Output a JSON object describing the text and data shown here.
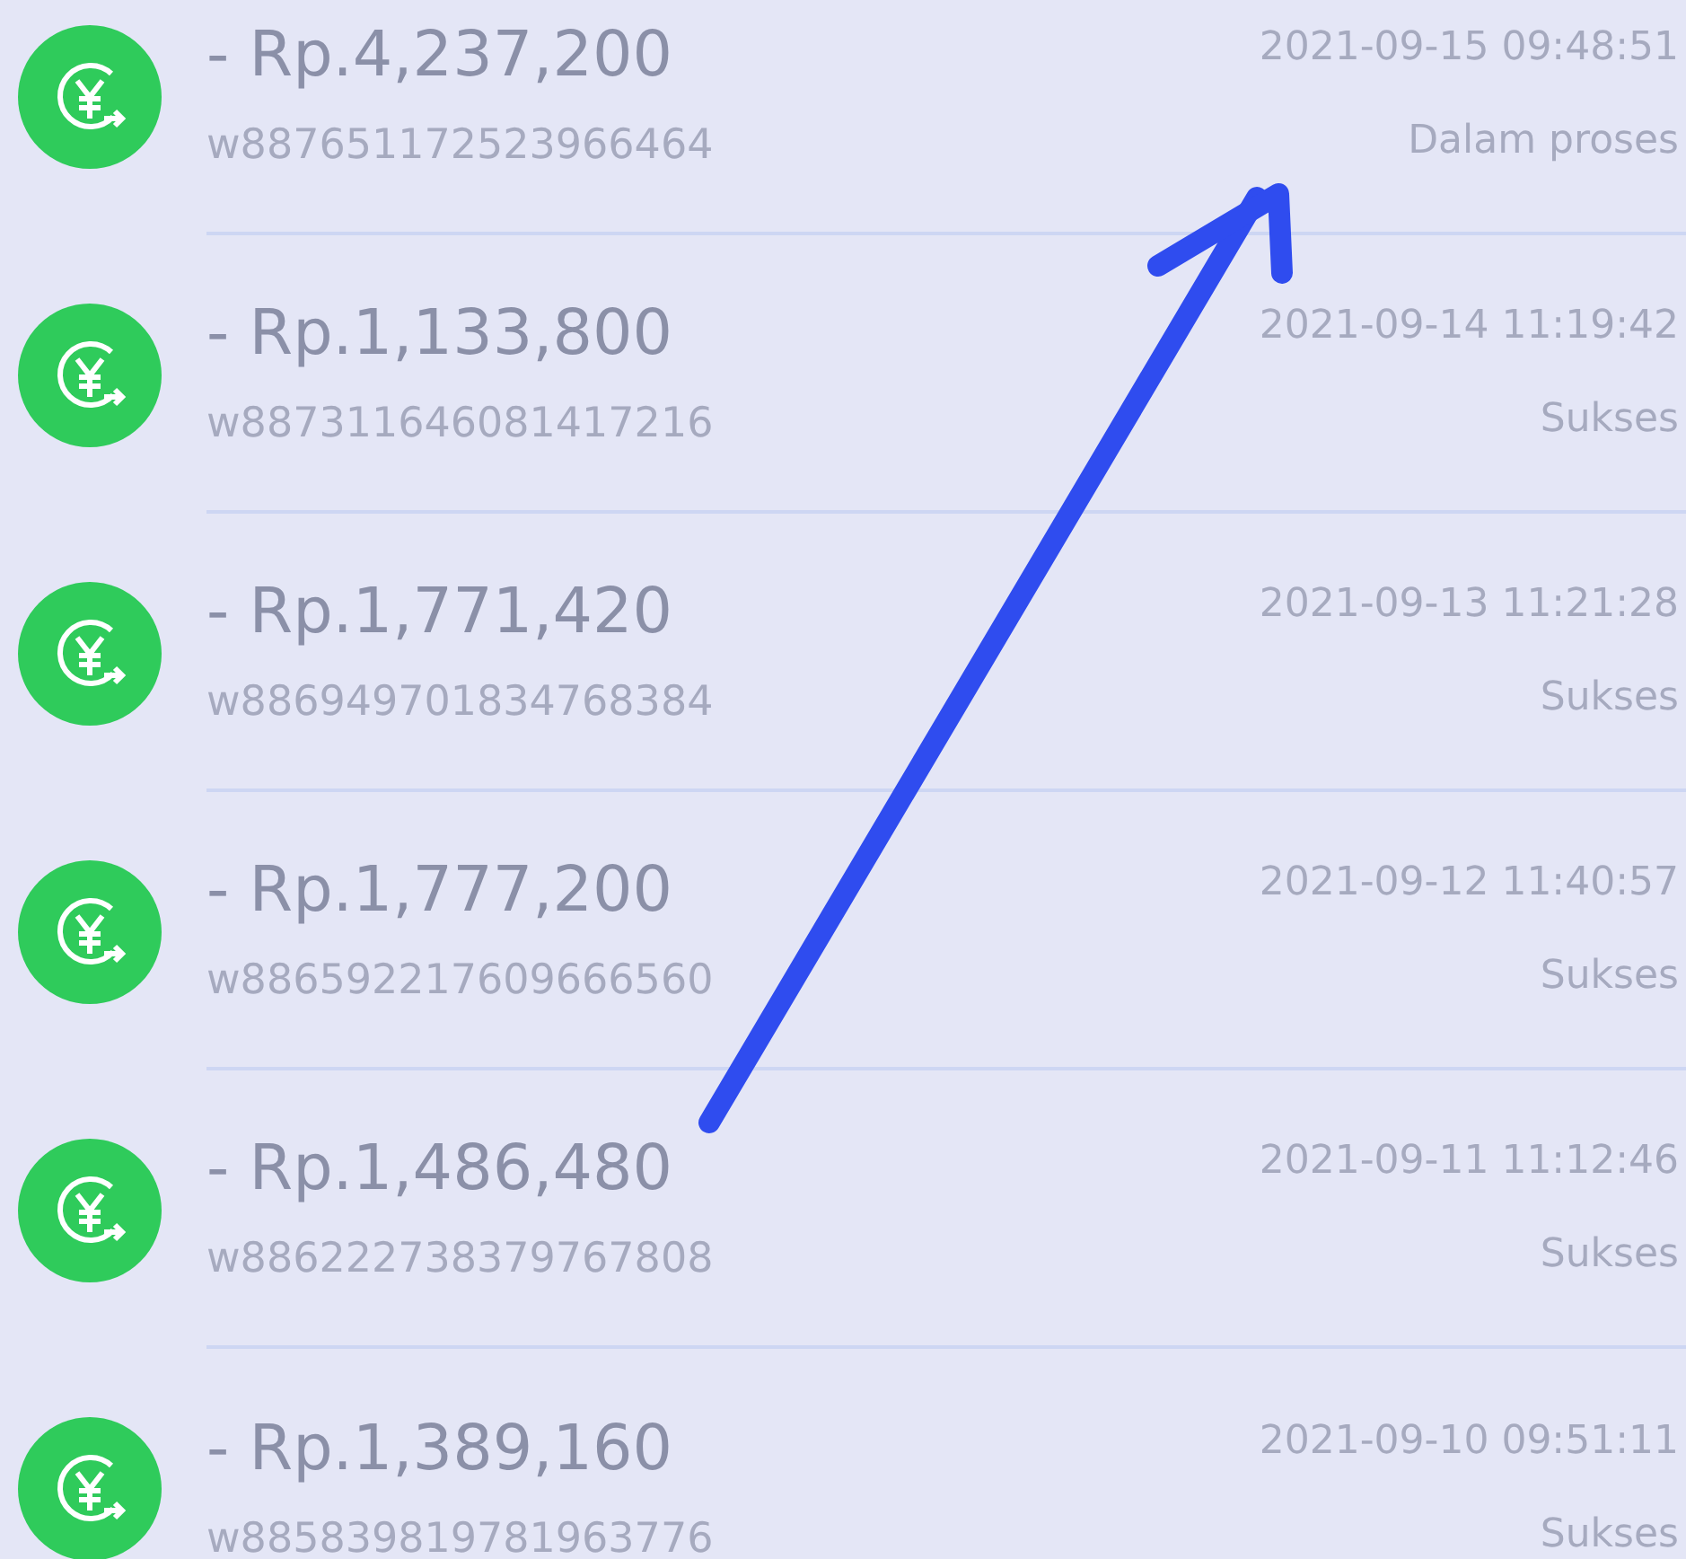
{
  "transactions": [
    {
      "amount": "- Rp.4,237,200",
      "id": "w887651172523966464",
      "time": "2021-09-15 09:48:51",
      "status": "Dalam proses"
    },
    {
      "amount": "- Rp.1,133,800",
      "id": "w887311646081417216",
      "time": "2021-09-14 11:19:42",
      "status": "Sukses"
    },
    {
      "amount": "- Rp.1,771,420",
      "id": "w886949701834768384",
      "time": "2021-09-13 11:21:28",
      "status": "Sukses"
    },
    {
      "amount": "- Rp.1,777,200",
      "id": "w886592217609666560",
      "time": "2021-09-12 11:40:57",
      "status": "Sukses"
    },
    {
      "amount": "- Rp.1,486,480",
      "id": "w886222738379767808",
      "time": "2021-09-11 11:12:46",
      "status": "Sukses"
    },
    {
      "amount": "- Rp.1,389,160",
      "id": "w885839819781963776",
      "time": "2021-09-10 09:51:11",
      "status": "Sukses"
    }
  ]
}
